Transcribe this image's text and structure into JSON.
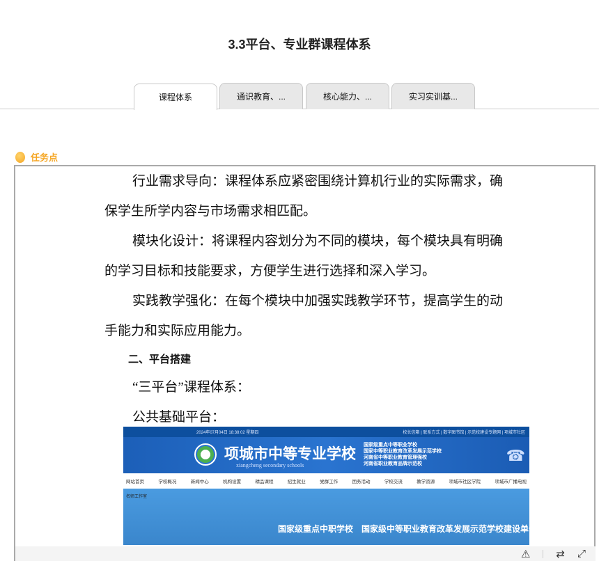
{
  "page": {
    "title": "3.3平台、专业群课程体系"
  },
  "tabs": [
    {
      "label": "课程体系",
      "active": true
    },
    {
      "label": "通识教育、..."
    },
    {
      "label": "核心能力、..."
    },
    {
      "label": "实习实训基..."
    }
  ],
  "task": {
    "label": "任务点",
    "color": "#f5a623"
  },
  "doc": {
    "lines": [
      "行业需求导向：课程体系应紧密围绕计算机行业的实际需求，确",
      "保学生所学内容与市场需求相匹配。",
      "模块化设计：将课程内容划分为不同的模块，每个模块具有明确",
      "的学习目标和技能要求，方便学生进行选择和深入学习。",
      "实践教学强化：在每个模块中加强实践教学环节，提高学生的动",
      "手能力和实际应用能力。"
    ],
    "heading": "二、平台搭建",
    "line2": "“三平台”课程体系：",
    "line3": "公共基础平台："
  },
  "screenshot": {
    "datetime": "2024年07月04日 18:38:02 星期四",
    "toplinks": "校长信箱 | 联系方式 | 数字图书馆 | 示范校建设专题网 | 项城市社区",
    "school": "项城市中等专业学校",
    "school_en": "xiangcheng secondary schools",
    "honors": [
      "国家级重点中等职业学校",
      "国家中等职业教育改革发展示范学校",
      "河南省中等职业教育管理强校",
      "河南省职业教育品牌示范校"
    ],
    "nav": [
      "网站首页",
      "学校概况",
      "新闻中心",
      "机构设置",
      "精品课程",
      "招生就业",
      "党群工作",
      "团务活动",
      "学校交流",
      "教学资源",
      "项城市社区学院",
      "项城市广播电视"
    ],
    "sub": "名师工作室",
    "slogan": "国家级重点中职学校　国家级中等职业教育改革发展示范学校建设单位"
  },
  "toolbar": {
    "icons": [
      "warning-icon",
      "switch-icon",
      "fullscreen-icon"
    ]
  }
}
